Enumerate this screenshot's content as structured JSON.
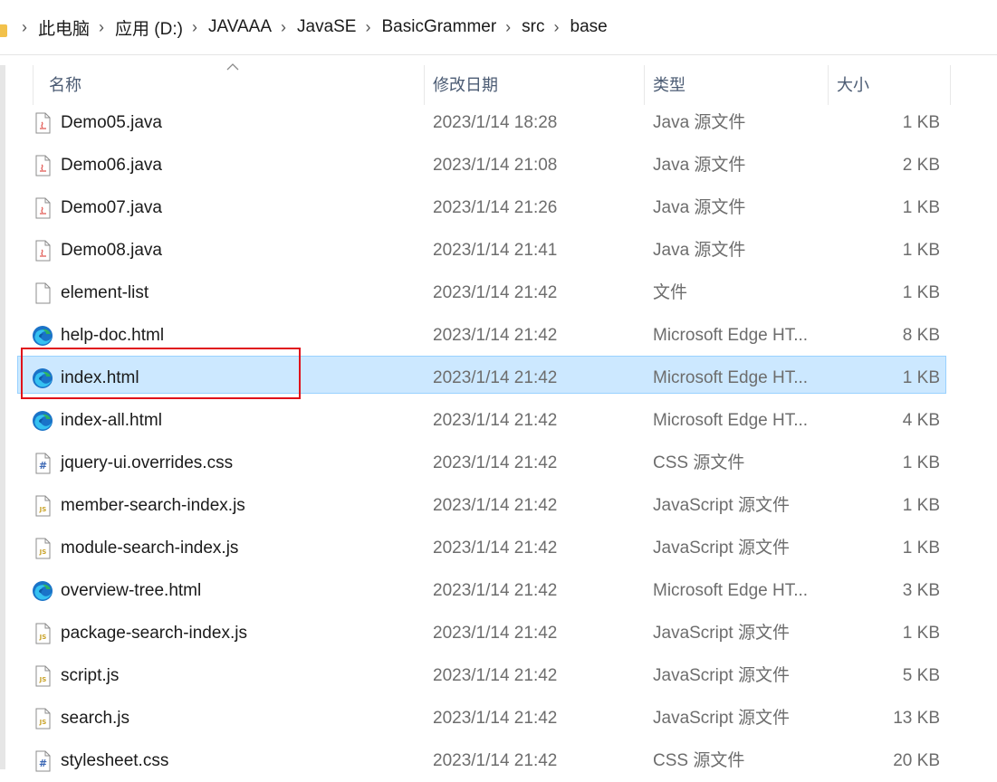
{
  "breadcrumb": [
    "此电脑",
    "应用 (D:)",
    "JAVAAA",
    "JavaSE",
    "BasicGrammer",
    "src",
    "base"
  ],
  "columns": {
    "name": "名称",
    "date": "修改日期",
    "type": "类型",
    "size": "大小"
  },
  "files": [
    {
      "name": "Demo05.java",
      "date": "2023/1/14 18:28",
      "type": "Java 源文件",
      "size": "1 KB",
      "icon": "java-file-icon"
    },
    {
      "name": "Demo06.java",
      "date": "2023/1/14 21:08",
      "type": "Java 源文件",
      "size": "2 KB",
      "icon": "java-file-icon"
    },
    {
      "name": "Demo07.java",
      "date": "2023/1/14 21:26",
      "type": "Java 源文件",
      "size": "1 KB",
      "icon": "java-file-icon"
    },
    {
      "name": "Demo08.java",
      "date": "2023/1/14 21:41",
      "type": "Java 源文件",
      "size": "1 KB",
      "icon": "java-file-icon"
    },
    {
      "name": "element-list",
      "date": "2023/1/14 21:42",
      "type": "文件",
      "size": "1 KB",
      "icon": "blank-file-icon"
    },
    {
      "name": "help-doc.html",
      "date": "2023/1/14 21:42",
      "type": "Microsoft Edge HT...",
      "size": "8 KB",
      "icon": "edge-icon"
    },
    {
      "name": "index.html",
      "date": "2023/1/14 21:42",
      "type": "Microsoft Edge HT...",
      "size": "1 KB",
      "icon": "edge-icon",
      "selected": true
    },
    {
      "name": "index-all.html",
      "date": "2023/1/14 21:42",
      "type": "Microsoft Edge HT...",
      "size": "4 KB",
      "icon": "edge-icon"
    },
    {
      "name": "jquery-ui.overrides.css",
      "date": "2023/1/14 21:42",
      "type": "CSS 源文件",
      "size": "1 KB",
      "icon": "css-file-icon"
    },
    {
      "name": "member-search-index.js",
      "date": "2023/1/14 21:42",
      "type": "JavaScript 源文件",
      "size": "1 KB",
      "icon": "js-file-icon"
    },
    {
      "name": "module-search-index.js",
      "date": "2023/1/14 21:42",
      "type": "JavaScript 源文件",
      "size": "1 KB",
      "icon": "js-file-icon"
    },
    {
      "name": "overview-tree.html",
      "date": "2023/1/14 21:42",
      "type": "Microsoft Edge HT...",
      "size": "3 KB",
      "icon": "edge-icon"
    },
    {
      "name": "package-search-index.js",
      "date": "2023/1/14 21:42",
      "type": "JavaScript 源文件",
      "size": "1 KB",
      "icon": "js-file-icon"
    },
    {
      "name": "script.js",
      "date": "2023/1/14 21:42",
      "type": "JavaScript 源文件",
      "size": "5 KB",
      "icon": "js-file-icon"
    },
    {
      "name": "search.js",
      "date": "2023/1/14 21:42",
      "type": "JavaScript 源文件",
      "size": "13 KB",
      "icon": "js-file-icon"
    },
    {
      "name": "stylesheet.css",
      "date": "2023/1/14 21:42",
      "type": "CSS 源文件",
      "size": "20 KB",
      "icon": "css-file-icon"
    }
  ],
  "colors": {
    "selection": "#cce8ff",
    "highlight_border": "#e0111b",
    "folder": "#f2c14b"
  }
}
